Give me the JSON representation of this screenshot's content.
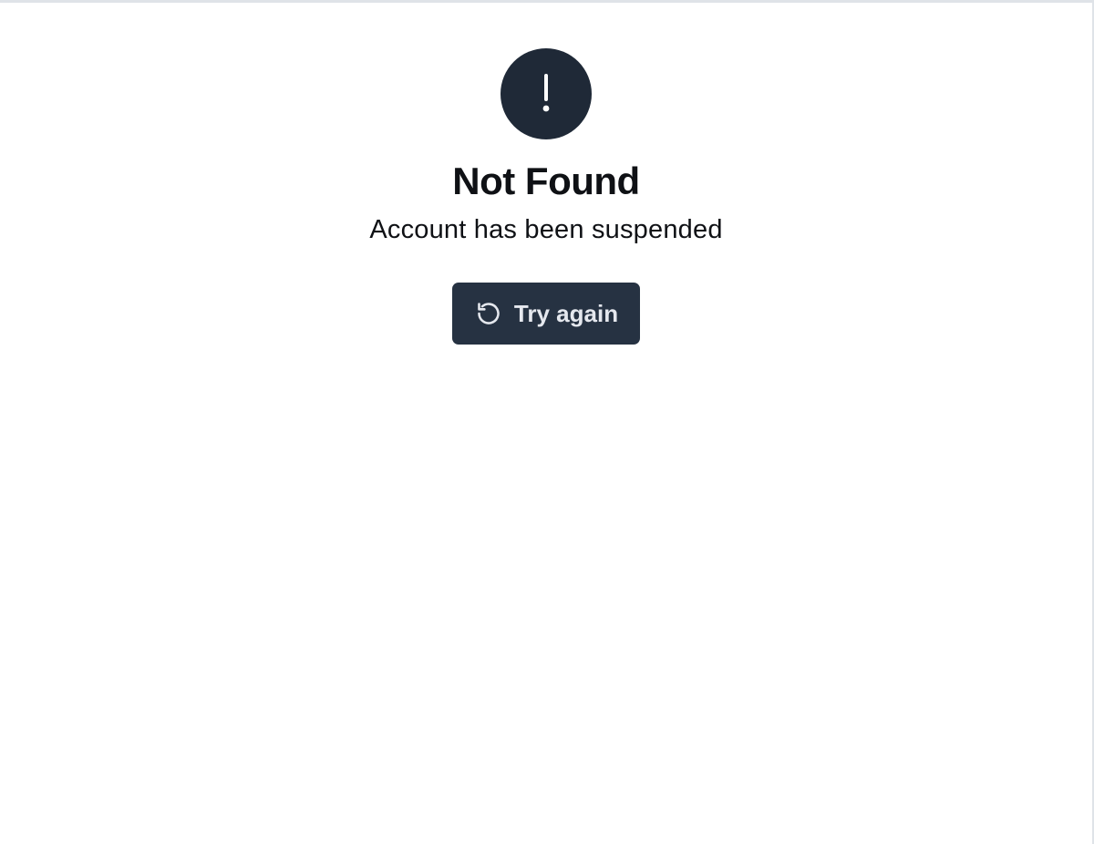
{
  "error": {
    "icon": "alert-exclamation-icon",
    "title": "Not Found",
    "message": "Account has been suspended"
  },
  "actions": {
    "retry_label": "Try again",
    "retry_icon": "refresh-icon"
  },
  "colors": {
    "icon_circle": "#1f2937",
    "button_bg": "#263242",
    "button_text": "#e5e8ee",
    "text": "#0f1115"
  }
}
